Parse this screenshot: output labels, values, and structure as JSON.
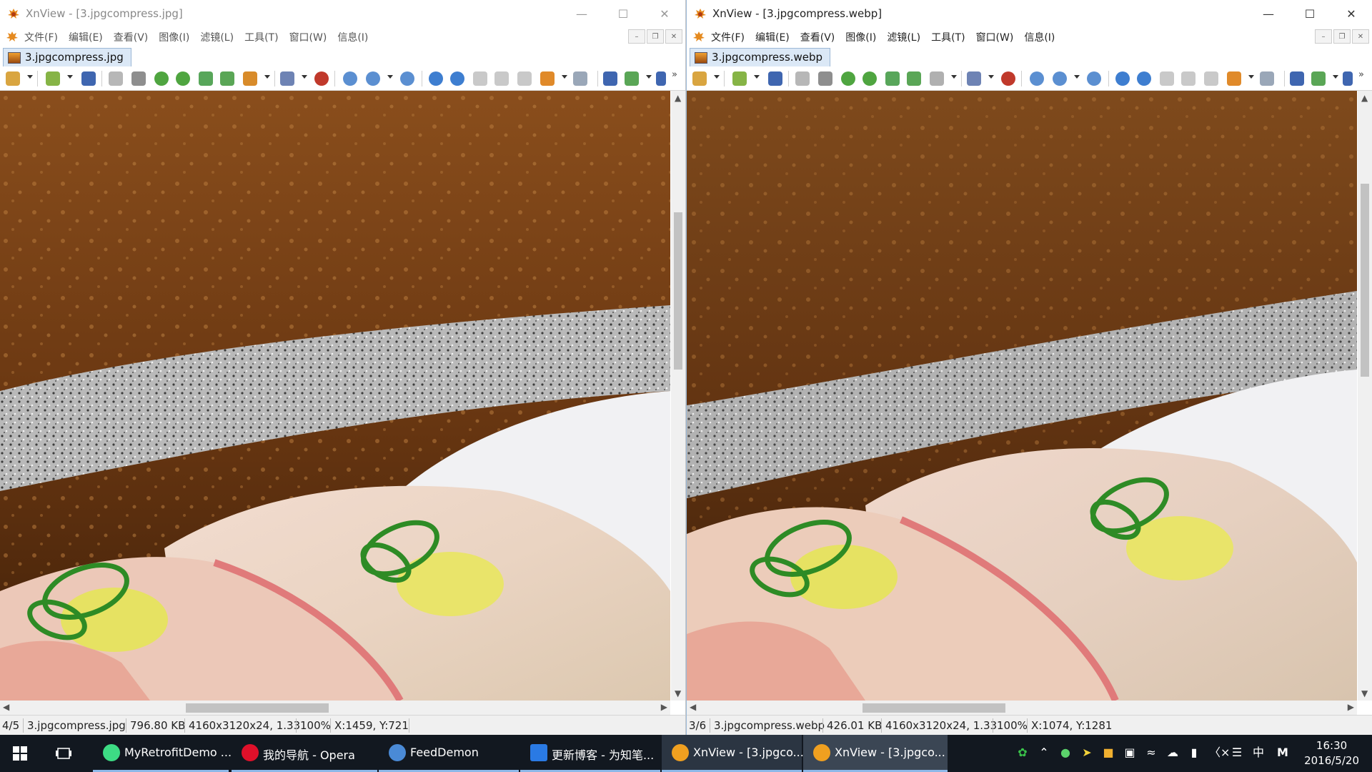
{
  "windows": [
    {
      "id": "left",
      "title": "XnView - [3.jpgcompress.jpg]",
      "menu": [
        "文件(F)",
        "编辑(E)",
        "查看(V)",
        "图像(I)",
        "滤镜(L)",
        "工具(T)",
        "窗口(W)",
        "信息(I)"
      ],
      "tab": "3.jpgcompress.jpg",
      "status": {
        "index": "4/5",
        "filename": "3.jpgcompress.jpg",
        "filesize": "796.80 KB",
        "dimensions": "4160x3120x24, 1.33",
        "zoom": "100%",
        "cursor": "X:1459, Y:721"
      }
    },
    {
      "id": "right",
      "title": "XnView - [3.jpgcompress.webp]",
      "menu": [
        "文件(F)",
        "编辑(E)",
        "查看(V)",
        "图像(I)",
        "滤镜(L)",
        "工具(T)",
        "窗口(W)",
        "信息(I)"
      ],
      "tab": "3.jpgcompress.webp",
      "status": {
        "index": "3/6",
        "filename": "3.jpgcompress.webp",
        "filesize": "426.01 KB",
        "dimensions": "4160x3120x24, 1.33",
        "zoom": "100%",
        "cursor": "X:1074, Y:1281"
      }
    }
  ],
  "taskbar": {
    "tasks": [
      {
        "label": "MyRetrofitDemo ...",
        "icon": "android-studio-icon",
        "color": "#3ddc84"
      },
      {
        "label": "我的导航 - Opera",
        "icon": "opera-icon",
        "color": "#e0102a"
      },
      {
        "label": "FeedDemon",
        "icon": "feeddemon-icon",
        "color": "#4a8ad6"
      },
      {
        "label": "更新博客 - 为知笔...",
        "icon": "wiznote-icon",
        "color": "#2a7ae4"
      },
      {
        "label": "XnView - [3.jpgco...",
        "icon": "xnview-icon",
        "color": "#f0a020"
      },
      {
        "label": "XnView - [3.jpgco...",
        "icon": "xnview-icon",
        "color": "#f0a020"
      }
    ],
    "ime": "中",
    "time": "16:30",
    "date": "2016/5/20"
  },
  "colors": {
    "accent": "#3d8bd4",
    "taskbar": "#121820",
    "tab_active": "#dbe8f6"
  }
}
